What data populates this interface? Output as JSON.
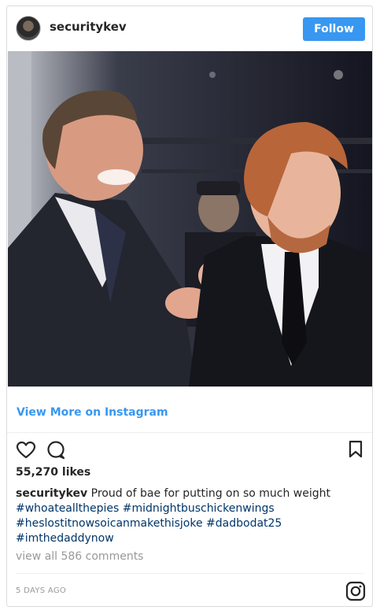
{
  "post": {
    "username": "securitykev",
    "follow_label": "Follow",
    "view_more_label": "View More on Instagram",
    "likes": "55,270 likes",
    "caption_user": "securitykev",
    "caption_text": " Proud of bae for putting on so much weight",
    "hashtags": [
      "#whoateallthepies",
      "#midnightbuschickenwings",
      "#heslostitnowsoicanmakethisjoke",
      "#dadbodat25",
      "#imthedaddynow"
    ],
    "comments_link": "view all 586 comments",
    "timestamp": "5 DAYS AGO"
  },
  "icons": {
    "like": "heart-icon",
    "comment": "comment-icon",
    "save": "bookmark-icon",
    "brand": "instagram-icon"
  },
  "colors": {
    "accent": "#3897f0",
    "hashtag": "#003569",
    "muted": "#999999",
    "text": "#262626"
  }
}
